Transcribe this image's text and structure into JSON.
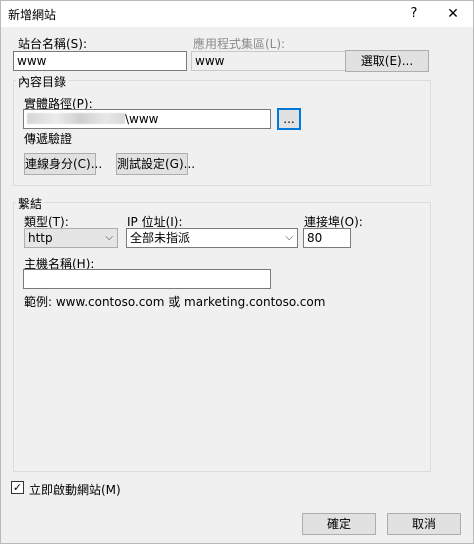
{
  "window": {
    "title": "新增網站",
    "help_glyph": "?",
    "close_glyph": "✕"
  },
  "site": {
    "name_label": "站台名稱(S):",
    "name_value": "www",
    "app_pool_label": "應用程式集區(L):",
    "app_pool_value": "www",
    "select_button": "選取(E)..."
  },
  "content_dir": {
    "group_title": "內容目錄",
    "physical_path_label": "實體路徑(P):",
    "physical_path_suffix": "\\www",
    "browse_button": "...",
    "pass_through_label": "傳遞驗證",
    "connect_as_button": "連線身分(C)...",
    "test_settings_button": "測試設定(G)..."
  },
  "binding": {
    "group_title": "繫結",
    "type_label": "類型(T):",
    "type_value": "http",
    "ip_label": "IP 位址(I):",
    "ip_value": "全部未指派",
    "port_label": "連接埠(O):",
    "port_value": "80",
    "host_label": "主機名稱(H):",
    "host_value": "",
    "example_text": "範例: www.contoso.com 或 marketing.contoso.com"
  },
  "start_site": {
    "label": "立即啟動網站(M)",
    "checked": true,
    "check_glyph": "✓"
  },
  "footer": {
    "ok_button": "確定",
    "cancel_button": "取消"
  }
}
